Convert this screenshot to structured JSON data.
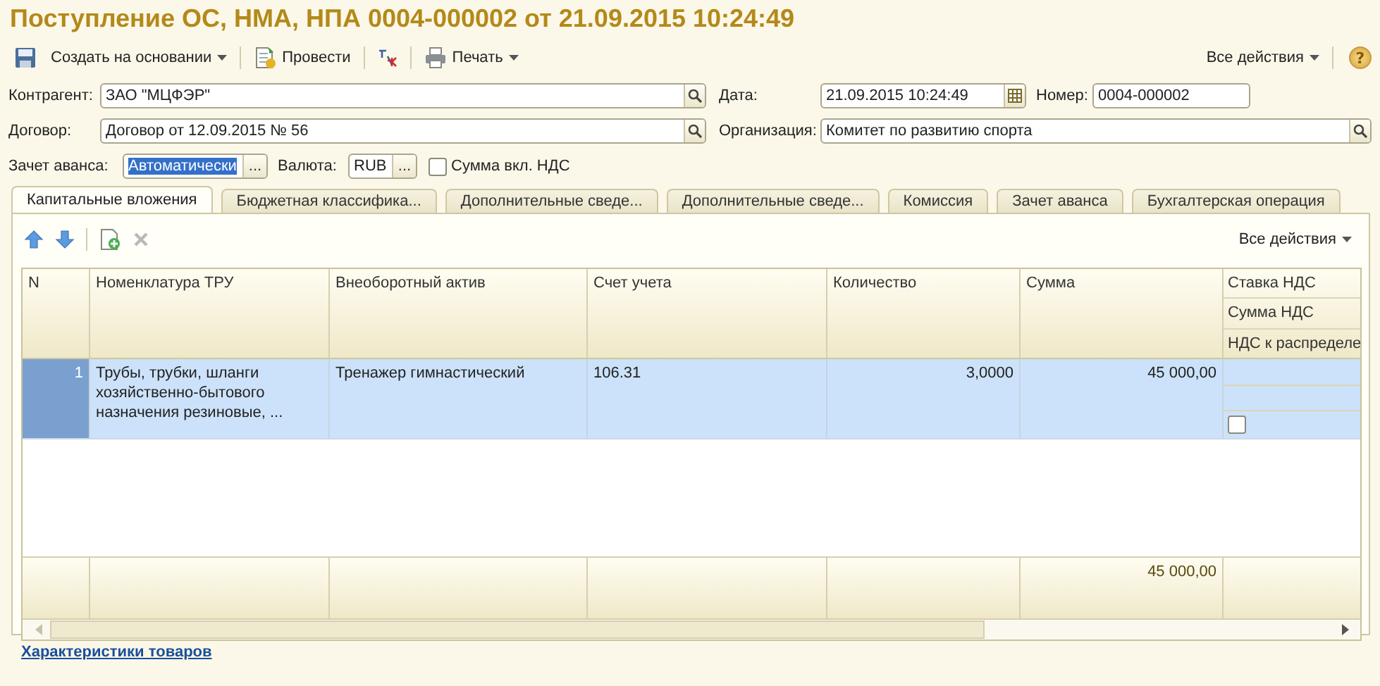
{
  "window": {
    "title": "Поступление ОС, НМА, НПА 0004-000002 от 21.09.2015 10:24:49"
  },
  "toolbar": {
    "items": [
      {
        "kind": "save"
      },
      {
        "kind": "menu",
        "label": "Создать на основании"
      },
      {
        "kind": "post",
        "label": "Провести"
      },
      {
        "kind": "ledger"
      },
      {
        "kind": "print",
        "label": "Печать"
      }
    ],
    "all_actions": "Все действия",
    "help": "?"
  },
  "form": {
    "contractor": {
      "label": "Контрагент:",
      "value": "ЗАО \"МЦФЭР\""
    },
    "date": {
      "label": "Дата:",
      "value": "21.09.2015 10:24:49"
    },
    "number": {
      "label": "Номер:",
      "value": "0004-000002"
    },
    "contract": {
      "label": "Договор:",
      "value": "Договор от 12.09.2015 № 56"
    },
    "organization": {
      "label": "Организация:",
      "value": "Комитет по развитию спорта"
    },
    "advance": {
      "label": "Зачет аванса:",
      "value": "Автоматически",
      "text_selected": true,
      "button": "..."
    },
    "currency": {
      "label": "Валюта:",
      "value": "RUB",
      "button": "..."
    },
    "vat_included": {
      "label": "Сумма вкл. НДС",
      "checked": false
    }
  },
  "tabs": [
    {
      "label": "Капитальные вложения",
      "selected": true
    },
    {
      "label": "Бюджетная классифика...",
      "selected": false
    },
    {
      "label": "Дополнительные сведе...",
      "selected": false
    },
    {
      "label": "Дополнительные сведе...",
      "selected": false
    },
    {
      "label": "Комиссия",
      "selected": false
    },
    {
      "label": "Зачет аванса",
      "selected": false
    },
    {
      "label": "Бухгалтерская операция",
      "selected": false
    }
  ],
  "table": {
    "tools": [
      {
        "kind": "up",
        "disabled": false
      },
      {
        "kind": "down",
        "disabled": false
      },
      {
        "kind": "add",
        "disabled": false
      },
      {
        "kind": "delete",
        "disabled": true
      }
    ],
    "all_actions": "Все действия",
    "columns": [
      {
        "kind": "number",
        "label": "N"
      },
      {
        "kind": "text",
        "label": "Номенклатура ТРУ"
      },
      {
        "kind": "text",
        "label": "Внеоборотный актив"
      },
      {
        "kind": "text",
        "label": "Счет учета"
      },
      {
        "kind": "number",
        "label": "Количество"
      },
      {
        "kind": "number",
        "label": "Сумма",
        "total": "45 000,00"
      },
      {
        "kind": "stacked",
        "labels": [
          "Ставка НДС",
          "Сумма НДС",
          "НДС к распределе"
        ]
      }
    ],
    "rows": [
      {
        "selected": true,
        "cells": [
          "1",
          "Трубы, трубки, шланги хозяйственно-бытового назначения резиновые, ...",
          "Тренажер гимнастический",
          "106.31",
          "3,0000",
          "45 000,00"
        ],
        "vat_to_distribute": false
      }
    ]
  },
  "link": "Характеристики товаров"
}
